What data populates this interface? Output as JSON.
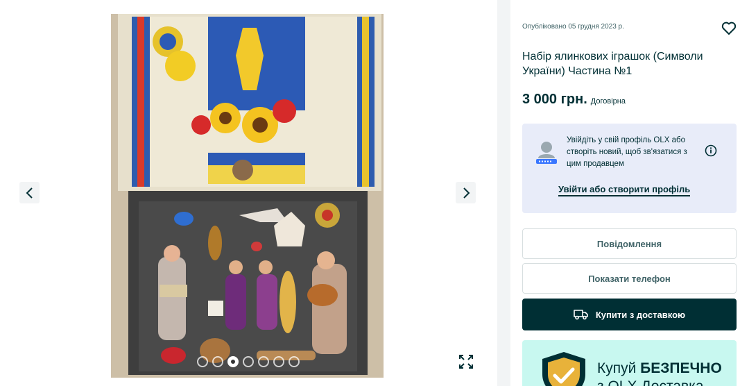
{
  "gallery": {
    "photo_alt": "",
    "dots_total": 7,
    "active_dot": 3
  },
  "listing": {
    "published": "Опубліковано 05 грудня 2023 р.",
    "title": "Набір ялинкових іграшок (Символи України) Частина №1",
    "price": "3 000 грн.",
    "price_note": "Договірна"
  },
  "login_prompt": {
    "text": "Увійдіть у свій профіль OLX або створіть новий, щоб зв'язатися з цим продавцем",
    "link": "Увійти або створити профіль"
  },
  "actions": {
    "message": "Повідомлення",
    "show_phone": "Показати телефон",
    "buy_delivery": "Купити з доставкою"
  },
  "promo": {
    "line1_regular": "Купуй ",
    "line1_bold": "БЕЗПЕЧНО",
    "line2": "з OLX Доставка"
  },
  "colors": {
    "brand_dark": "#002f34",
    "promo_bg": "#c8f8f0",
    "login_bg": "#e8ecf9"
  }
}
